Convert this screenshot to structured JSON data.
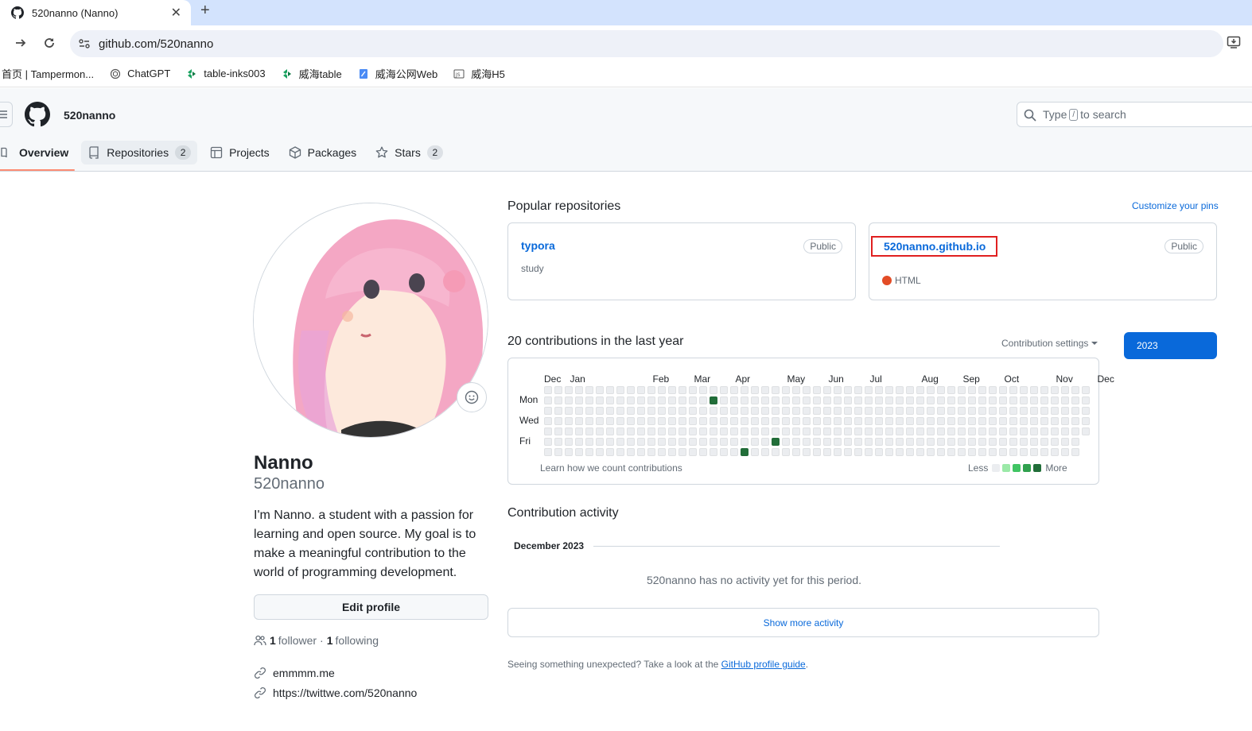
{
  "browser": {
    "tab_title": "520nanno (Nanno)",
    "url": "github.com/520nanno",
    "bookmarks": [
      {
        "label": "首页 | Tampermon...",
        "icon": "none"
      },
      {
        "label": "ChatGPT",
        "icon": "chatgpt-icon"
      },
      {
        "label": "table-inks003",
        "icon": "green-logo-icon"
      },
      {
        "label": "威海table",
        "icon": "green-logo-icon"
      },
      {
        "label": "威海公网Web",
        "icon": "doc-icon"
      },
      {
        "label": "威海H5",
        "icon": "js-icon"
      }
    ]
  },
  "header": {
    "username": "520nanno",
    "search_prefix": "Type",
    "search_key": "/",
    "search_suffix": "to search"
  },
  "nav": {
    "overview": "Overview",
    "repositories": "Repositories",
    "repositories_count": "2",
    "projects": "Projects",
    "packages": "Packages",
    "stars": "Stars",
    "stars_count": "2"
  },
  "profile": {
    "full_name": "Nanno",
    "login": "520nanno",
    "bio": "I'm Nanno. a student with a passion for learning and open source. My goal is to make a meaningful contribution to the world of programming development.",
    "edit_label": "Edit profile",
    "followers_count": "1",
    "followers_label": "follower",
    "separator": "·",
    "following_count": "1",
    "following_label": "following",
    "links": [
      "emmmm.me",
      "https://twittwe.com/520nanno"
    ]
  },
  "popular": {
    "title": "Popular repositories",
    "customize": "Customize your pins",
    "repos": [
      {
        "name": "typora",
        "badge": "Public",
        "description": "study"
      },
      {
        "name": "520nanno.github.io",
        "badge": "Public",
        "language": "HTML",
        "language_color": "#e34c26"
      }
    ]
  },
  "contributions": {
    "title": "20 contributions in the last year",
    "settings": "Contribution settings",
    "year": "2023",
    "months": [
      "Dec",
      "Jan",
      "Feb",
      "Mar",
      "Apr",
      "May",
      "Jun",
      "Jul",
      "Aug",
      "Sep",
      "Oct",
      "Nov",
      "Dec"
    ],
    "days": [
      "Mon",
      "Wed",
      "Fri"
    ],
    "learn": "Learn how we count contributions",
    "legend_less": "Less",
    "legend_more": "More",
    "colors": [
      "#ebedf0",
      "#9be9a8",
      "#40c463",
      "#30a14e",
      "#216e39"
    ],
    "active_days": [
      {
        "week": 16,
        "day": 1,
        "level": 4
      },
      {
        "week": 19,
        "day": 6,
        "level": 4
      },
      {
        "week": 22,
        "day": 5,
        "level": 4
      }
    ]
  },
  "activity": {
    "title": "Contribution activity",
    "month": "December 2023",
    "empty": "520nanno has no activity yet for this period.",
    "show_more": "Show more activity",
    "footer_prefix": "Seeing something unexpected? Take a look at the",
    "footer_link": "GitHub profile guide",
    "footer_suffix": "."
  }
}
